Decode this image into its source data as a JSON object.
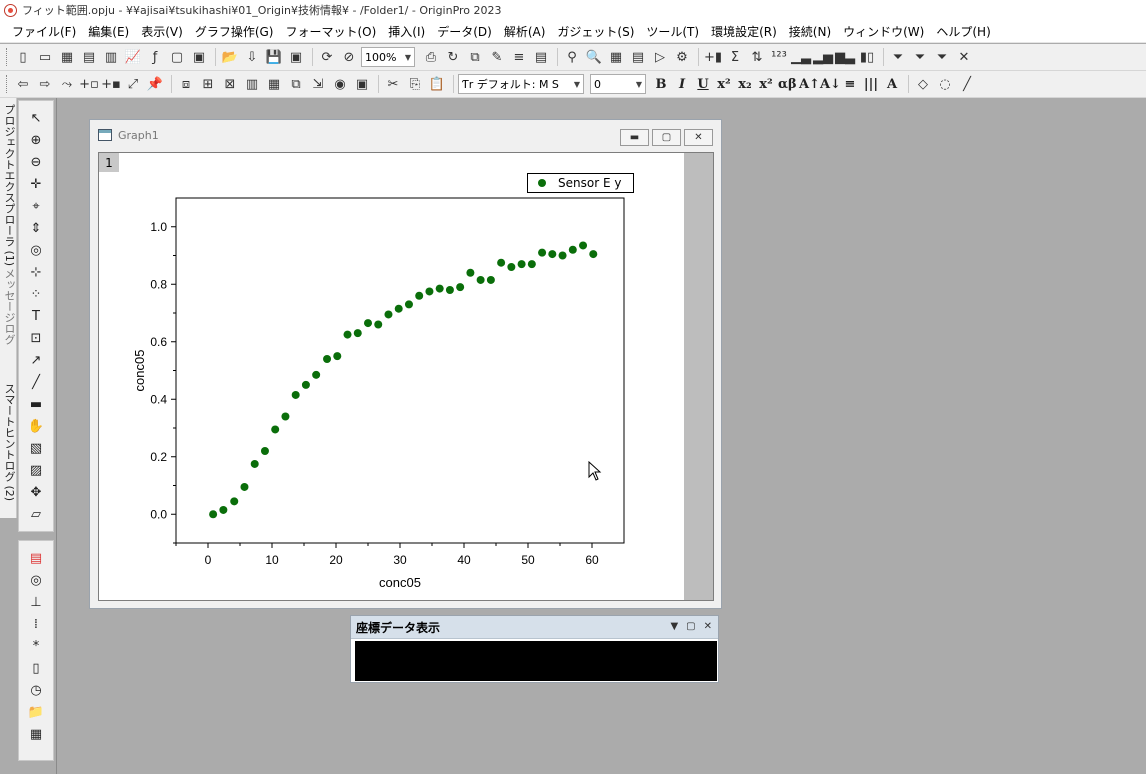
{
  "window": {
    "title": "フィット範囲.opju - ¥¥ajisai¥tsukihashi¥01_Origin¥技術情報¥ - /Folder1/ - OriginPro 2023"
  },
  "menu": [
    "ファイル(F)",
    "編集(E)",
    "表示(V)",
    "グラフ操作(G)",
    "フォーマット(O)",
    "挿入(I)",
    "データ(D)",
    "解析(A)",
    "ガジェット(S)",
    "ツール(T)",
    "環境設定(R)",
    "接続(N)",
    "ウィンドウ(W)",
    "ヘルプ(H)"
  ],
  "toolbar": {
    "zoom": "100%",
    "font": "Ƭr デフォルト: M S",
    "font_size": "0"
  },
  "side_tabs": [
    "プロジェクトエクスプローラ (1)",
    "メッセージログ",
    "スマートヒントログ (2)"
  ],
  "graph_window": {
    "title": "Graph1",
    "layer": "1",
    "legend": "Sensor E y",
    "xlabel": "conc05",
    "ylabel": "conc05"
  },
  "chart_data": {
    "type": "scatter",
    "color": "#0a6e0a",
    "xlim": [
      -5,
      65
    ],
    "ylim": [
      -0.1,
      1.1
    ],
    "xticks": [
      0,
      10,
      20,
      30,
      40,
      50,
      60
    ],
    "yticks": [
      0.0,
      0.2,
      0.4,
      0.6,
      0.8,
      1.0
    ],
    "xtick_labels": [
      "0",
      "10",
      "20",
      "30",
      "40",
      "50",
      "60"
    ],
    "ytick_labels": [
      "0.0",
      "0.2",
      "0.4",
      "0.6",
      "0.8",
      "1.0"
    ],
    "series": [
      {
        "name": "Sensor E y",
        "x": [
          0.8,
          2.4,
          4.1,
          5.7,
          7.3,
          8.9,
          10.5,
          12.1,
          13.7,
          15.3,
          16.9,
          18.6,
          20.2,
          21.8,
          23.4,
          25.0,
          26.6,
          28.2,
          29.8,
          31.4,
          33.0,
          34.6,
          36.2,
          37.8,
          39.4,
          41.0,
          42.6,
          44.2,
          45.8,
          47.4,
          49.0,
          50.6,
          52.2,
          53.8,
          55.4,
          57.0,
          58.6,
          60.2
        ],
        "y": [
          0.0,
          0.015,
          0.045,
          0.095,
          0.175,
          0.22,
          0.295,
          0.34,
          0.415,
          0.45,
          0.485,
          0.54,
          0.55,
          0.625,
          0.63,
          0.665,
          0.66,
          0.695,
          0.715,
          0.73,
          0.76,
          0.775,
          0.785,
          0.78,
          0.79,
          0.84,
          0.815,
          0.815,
          0.875,
          0.86,
          0.87,
          0.87,
          0.91,
          0.905,
          0.9,
          0.92,
          0.935,
          0.905
        ]
      }
    ]
  },
  "coord_panel": {
    "title": "座標データ表示"
  }
}
